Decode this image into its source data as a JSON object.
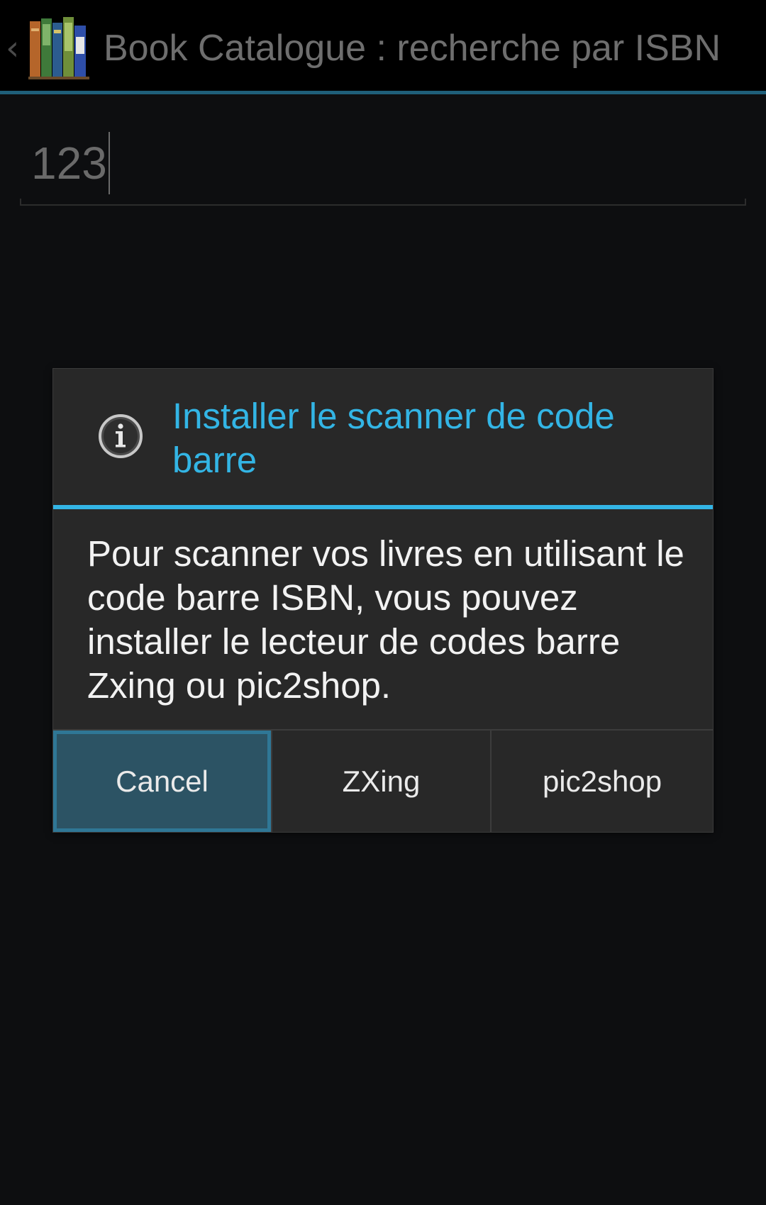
{
  "action_bar": {
    "title": "Book Catalogue : recherche par ISBN",
    "up_glyph": "‹",
    "icons": [
      "back-caret-icon",
      "book-catalogue-app-icon"
    ]
  },
  "isbn_input": {
    "value": "123"
  },
  "dialog": {
    "icon": "info-icon",
    "title": "Installer le scanner de code barre",
    "message": "Pour scanner vos livres en utilisant le code barre ISBN, vous pouvez installer le lecteur de codes barre Zxing ou pic2shop.",
    "buttons": {
      "cancel": "Cancel",
      "zxing": "ZXing",
      "pic2shop": "pic2shop"
    }
  },
  "colors": {
    "accent": "#33b5e5",
    "dialog_background": "#282828",
    "focused_button": "#2c5364",
    "screen_background": "#0d0e10"
  }
}
